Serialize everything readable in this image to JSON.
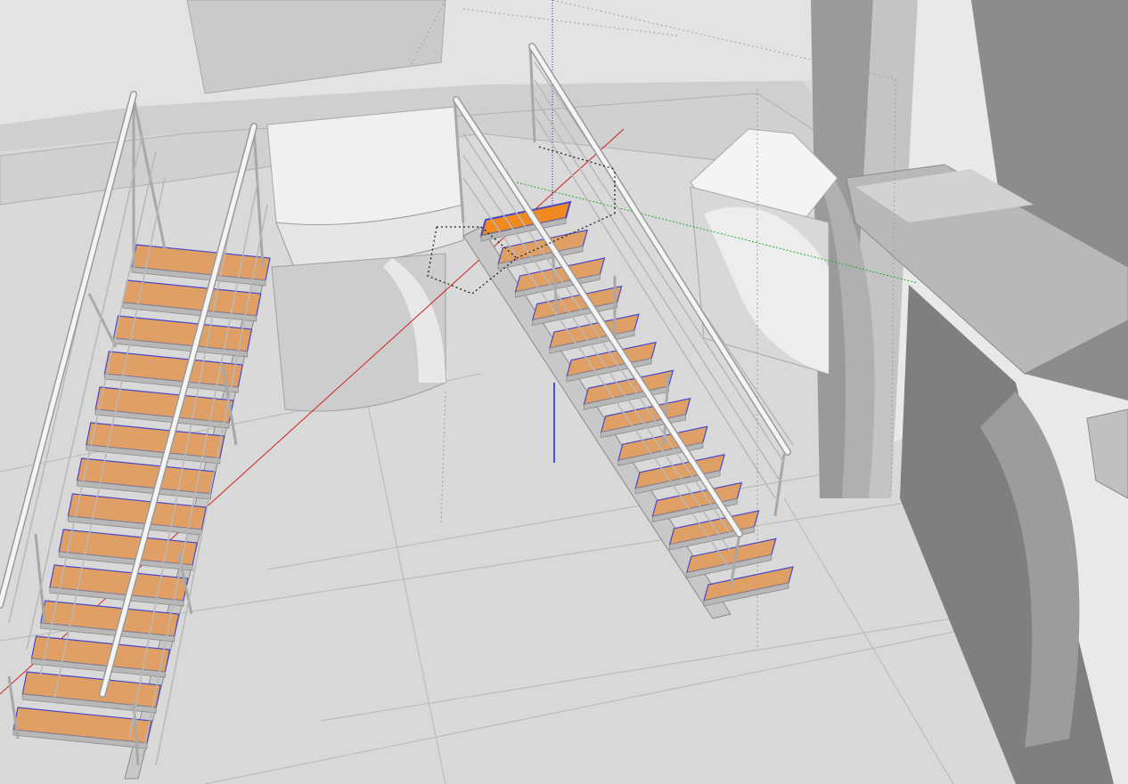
{
  "viewport": {
    "kind": "3d-modeling-viewport",
    "colors": {
      "floor": "#dcdcdc",
      "wall_light": "#ececec",
      "wall_mid": "#cfcfcf",
      "wall_dark": "#8a8a8a",
      "tread": "#e0a065",
      "tread_selected": "#f08a20",
      "tread_edge": "#4848c8",
      "rail": "#f4f4f4",
      "rail_outline": "#9a9a9a",
      "axis_red": "#d02020",
      "axis_green": "#20b020",
      "axis_blue": "#2020c0"
    }
  },
  "scene": {
    "staircases": [
      {
        "name": "left-staircase",
        "tread_count": 14,
        "selected_tread": null
      },
      {
        "name": "right-staircase",
        "tread_count": 14,
        "selected_tread": 0
      }
    ],
    "icons": [
      "model-axes-icon"
    ]
  }
}
